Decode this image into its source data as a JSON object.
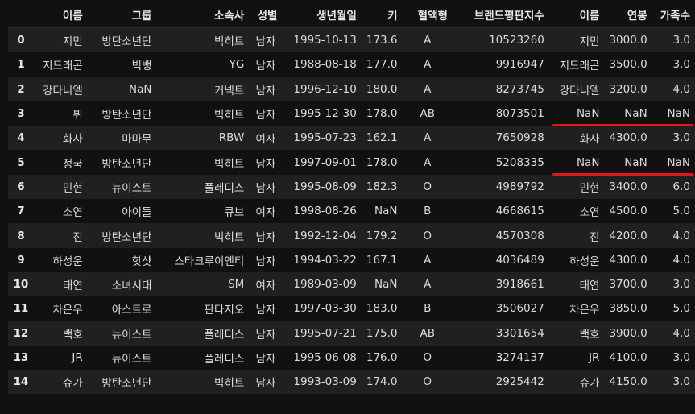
{
  "columns": [
    "",
    "이름",
    "그룹",
    "소속사",
    "성별",
    "생년월일",
    "키",
    "혈액형",
    "브랜드평판지수",
    "이름",
    "연봉",
    "가족수"
  ],
  "rows": [
    [
      "0",
      "지민",
      "방탄소년단",
      "빅히트",
      "남자",
      "1995-10-13",
      "173.6",
      "A",
      "10523260",
      "지민",
      "3000.0",
      "3.0"
    ],
    [
      "1",
      "지드래곤",
      "빅뱅",
      "YG",
      "남자",
      "1988-08-18",
      "177.0",
      "A",
      "9916947",
      "지드래곤",
      "3500.0",
      "3.0"
    ],
    [
      "2",
      "강다니엘",
      "NaN",
      "커넥트",
      "남자",
      "1996-12-10",
      "180.0",
      "A",
      "8273745",
      "강다니엘",
      "3200.0",
      "4.0"
    ],
    [
      "3",
      "뷔",
      "방탄소년단",
      "빅히트",
      "남자",
      "1995-12-30",
      "178.0",
      "AB",
      "8073501",
      "NaN",
      "NaN",
      "NaN"
    ],
    [
      "4",
      "화사",
      "마마무",
      "RBW",
      "여자",
      "1995-07-23",
      "162.1",
      "A",
      "7650928",
      "화사",
      "4300.0",
      "3.0"
    ],
    [
      "5",
      "정국",
      "방탄소년단",
      "빅히트",
      "남자",
      "1997-09-01",
      "178.0",
      "A",
      "5208335",
      "NaN",
      "NaN",
      "NaN"
    ],
    [
      "6",
      "민현",
      "뉴이스트",
      "플레디스",
      "남자",
      "1995-08-09",
      "182.3",
      "O",
      "4989792",
      "민현",
      "3400.0",
      "6.0"
    ],
    [
      "7",
      "소연",
      "아이들",
      "큐브",
      "여자",
      "1998-08-26",
      "NaN",
      "B",
      "4668615",
      "소연",
      "4500.0",
      "5.0"
    ],
    [
      "8",
      "진",
      "방탄소년단",
      "빅히트",
      "남자",
      "1992-12-04",
      "179.2",
      "O",
      "4570308",
      "진",
      "4200.0",
      "4.0"
    ],
    [
      "9",
      "하성운",
      "핫샷",
      "스타크루이엔티",
      "남자",
      "1994-03-22",
      "167.1",
      "A",
      "4036489",
      "하성운",
      "4300.0",
      "4.0"
    ],
    [
      "10",
      "태연",
      "소녀시대",
      "SM",
      "여자",
      "1989-03-09",
      "NaN",
      "A",
      "3918661",
      "태연",
      "3700.0",
      "3.0"
    ],
    [
      "11",
      "차은우",
      "아스트로",
      "판타지오",
      "남자",
      "1997-03-30",
      "183.0",
      "B",
      "3506027",
      "차은우",
      "3850.0",
      "5.0"
    ],
    [
      "12",
      "백호",
      "뉴이스트",
      "플레디스",
      "남자",
      "1995-07-21",
      "175.0",
      "AB",
      "3301654",
      "백호",
      "3900.0",
      "4.0"
    ],
    [
      "13",
      "JR",
      "뉴이스트",
      "플레디스",
      "남자",
      "1995-06-08",
      "176.0",
      "O",
      "3274137",
      "JR",
      "4100.0",
      "3.0"
    ],
    [
      "14",
      "슈가",
      "방탄소년단",
      "빅히트",
      "남자",
      "1993-03-09",
      "174.0",
      "O",
      "2925442",
      "슈가",
      "4150.0",
      "3.0"
    ]
  ],
  "highlighted_rows": [
    3,
    5
  ],
  "colors": {
    "background": "#111111",
    "stripe": "#202020",
    "text": "#dcdcdc",
    "highlight": "#e0161e"
  }
}
